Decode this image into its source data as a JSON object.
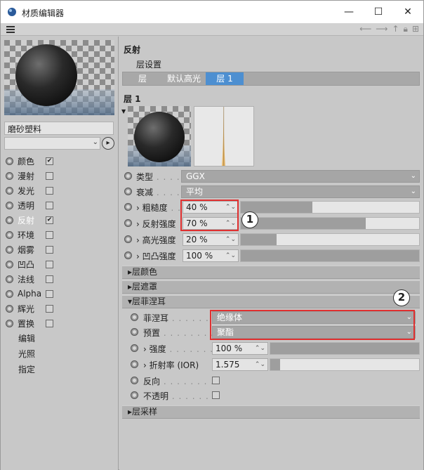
{
  "window": {
    "title": "材质编辑器",
    "minimize": "—",
    "maximize": "☐",
    "close": "✕"
  },
  "material": {
    "name": "磨砂塑料"
  },
  "channels": [
    {
      "label": "颜色",
      "checked": true
    },
    {
      "label": "漫射",
      "checked": false
    },
    {
      "label": "发光",
      "checked": false
    },
    {
      "label": "透明",
      "checked": false
    },
    {
      "label": "反射",
      "checked": true,
      "active": true
    },
    {
      "label": "环境",
      "checked": false
    },
    {
      "label": "烟雾",
      "checked": false
    },
    {
      "label": "凹凸",
      "checked": false
    },
    {
      "label": "法线",
      "checked": false
    },
    {
      "label": "Alpha",
      "checked": false
    },
    {
      "label": "辉光",
      "checked": false
    },
    {
      "label": "置换",
      "checked": false
    }
  ],
  "extra_items": [
    "编辑",
    "光照",
    "指定"
  ],
  "panel": {
    "title": "反射",
    "layer_settings": "层设置",
    "tabs": [
      "层",
      "默认高光",
      "层 1"
    ],
    "active_tab": 2,
    "layer_title": "层 1"
  },
  "props": {
    "type_label": "类型",
    "type_value": "GGX",
    "attenuation_label": "衰减",
    "attenuation_value": "平均",
    "roughness_label": "粗糙度",
    "roughness_value": "40 %",
    "roughness_level": 0.4,
    "refl_strength_label": "反射强度",
    "refl_strength_value": "70 %",
    "refl_strength_level": 0.7,
    "spec_strength_label": "高光强度",
    "spec_strength_value": "20 %",
    "spec_strength_level": 0.2,
    "bump_strength_label": "凹凸强度",
    "bump_strength_value": "100 %",
    "bump_strength_level": 1.0
  },
  "groups": {
    "layer_color": "层颜色",
    "layer_mask": "层遮罩",
    "layer_fresnel": "层菲涅耳",
    "layer_sampling": "层采样"
  },
  "fresnel": {
    "fresnel_label": "菲涅耳",
    "fresnel_value": "绝缘体",
    "preset_label": "预置",
    "preset_value": "聚酯",
    "strength_label": "强度",
    "strength_value": "100 %",
    "ior_label": "折射率 (IOR)",
    "ior_value": "1.575",
    "invert_label": "反向",
    "opaque_label": "不透明"
  },
  "callouts": [
    "1",
    "2"
  ],
  "colors": {
    "accent": "#4d8fd1",
    "callout": "#e03030",
    "panel_bg": "#c8c8c8"
  }
}
